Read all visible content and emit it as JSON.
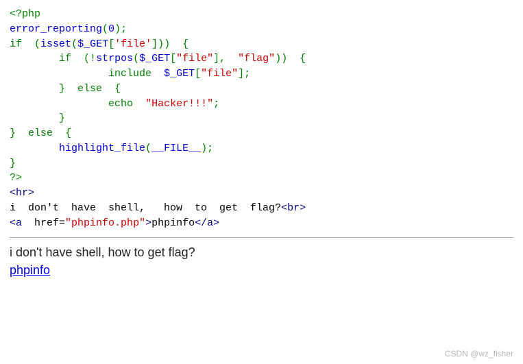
{
  "code": {
    "open_tag": "<?php",
    "err_fn": "error_reporting",
    "zero": "0",
    "if_kw": "if",
    "isset_fn": "isset",
    "get_var": "$_GET",
    "file_key_sq": "'file'",
    "strpos_fn": "strpos",
    "file_key_dq": "\"file\"",
    "flag_str": "\"flag\"",
    "include_kw": "include",
    "else_kw": "else",
    "echo_kw": "echo",
    "hacker_str": "\"Hacker!!!\"",
    "highlight_fn": "highlight_file",
    "file_const": "__FILE__",
    "close_tag": "?>",
    "hr_tag_open": "<",
    "hr_tag_name": "hr",
    "hr_tag_close": ">",
    "line_i": "i  don't  have  shell,   how  to  get  flag?",
    "br_open": "<",
    "br_name": "br",
    "br_close": ">",
    "a_open": "<",
    "a_name": "a",
    "href_attr": "  href=",
    "href_val": "\"phpinfo.php\"",
    "a_close_ang": ">",
    "link_text": "phpinfo",
    "a_end": "</a>"
  },
  "rendered": {
    "question": "i don't have shell, how to get flag?",
    "link": "phpinfo"
  },
  "watermark": "CSDN @wz_fisher"
}
